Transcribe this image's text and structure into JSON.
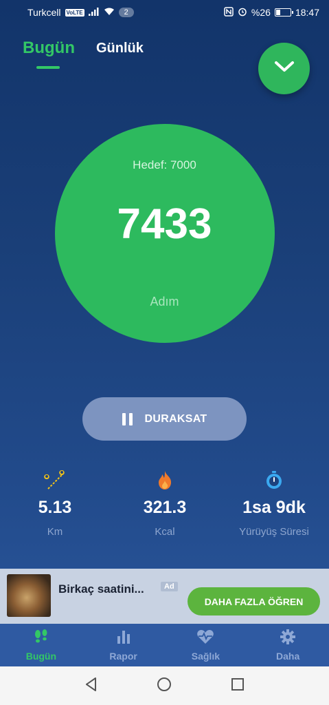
{
  "status_bar": {
    "carrier": "Turkcell",
    "volte": "VoLTE",
    "badge_count": "2",
    "battery": "%26",
    "time": "18:47"
  },
  "tabs": {
    "today": "Bugün",
    "daily": "Günlük"
  },
  "steps": {
    "goal_label": "Hedef: 7000",
    "count": "7433",
    "unit": "Adım",
    "progress_fraction": 1.0
  },
  "pause_button": {
    "label": "DURAKSAT"
  },
  "stats": [
    {
      "icon": "location-pins-icon",
      "value": "5.13",
      "label": "Km"
    },
    {
      "icon": "flame-icon",
      "value": "321.3",
      "label": "Kcal"
    },
    {
      "icon": "stopwatch-icon",
      "value": "1sa 9dk",
      "label": "Yürüyüş Süresi"
    }
  ],
  "ad": {
    "title": "Birkaç saatini...",
    "badge": "Ad",
    "cta": "DAHA FAZLA ÖĞREN"
  },
  "bottom_nav": [
    {
      "icon": "footsteps-icon",
      "label": "Bugün",
      "active": true
    },
    {
      "icon": "bar-chart-icon",
      "label": "Rapor",
      "active": false
    },
    {
      "icon": "heart-pulse-icon",
      "label": "Sağlık",
      "active": false
    },
    {
      "icon": "gear-icon",
      "label": "Daha",
      "active": false
    }
  ],
  "colors": {
    "accent_green": "#33c766",
    "circle_green": "#2dba5e",
    "background_top": "#12346a",
    "nav_background": "#2f5aa2"
  }
}
